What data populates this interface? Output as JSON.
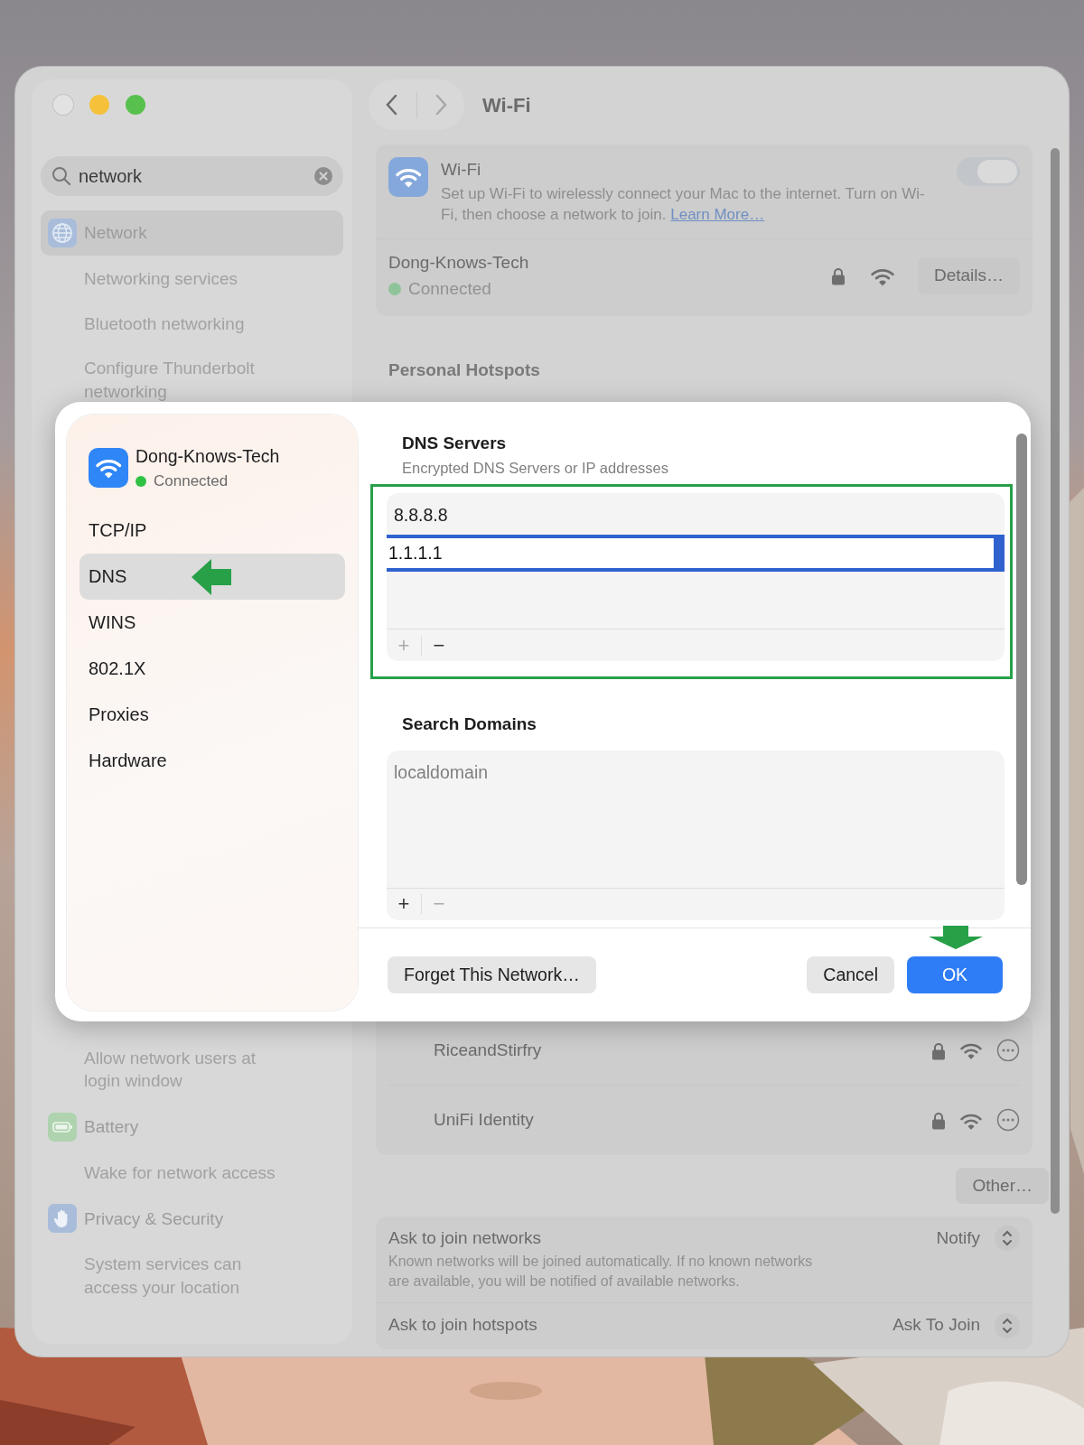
{
  "window": {
    "title": "Wi-Fi",
    "search": {
      "value": "network"
    }
  },
  "sidebar": {
    "top_items": [
      {
        "label": "Network",
        "kind": "pane",
        "selected": true
      },
      {
        "label": "Networking services",
        "kind": "sub",
        "selected": false
      },
      {
        "label": "Bluetooth networking",
        "kind": "sub",
        "selected": false
      },
      {
        "label": "Configure Thunderbolt networking",
        "kind": "sub",
        "selected": false
      }
    ],
    "bottom_items": [
      {
        "label": "Allow network users at login window",
        "kind": "sub",
        "selected": false
      },
      {
        "label": "Battery",
        "kind": "pane",
        "selected": false
      },
      {
        "label": "Wake for network access",
        "kind": "sub",
        "selected": false
      },
      {
        "label": "Privacy & Security",
        "kind": "pane",
        "selected": false
      },
      {
        "label": "System services can access your location",
        "kind": "sub",
        "selected": false
      }
    ]
  },
  "wifi_card": {
    "title": "Wi-Fi",
    "description": "Set up Wi-Fi to wirelessly connect your Mac to the internet. Turn on Wi-Fi, then choose a network to join.",
    "link": "Learn More…",
    "on": true,
    "network": {
      "name": "Dong-Knows-Tech",
      "status": "Connected",
      "button": "Details…"
    }
  },
  "personal_hotspots": {
    "heading": "Personal Hotspots"
  },
  "other_networks": [
    {
      "name": "RiceandStirfry"
    },
    {
      "name": "UniFi Identity"
    }
  ],
  "other_button": "Other…",
  "settings": [
    {
      "label": "Ask to join networks",
      "description": "Known networks will be joined automatically. If no known networks are available, you will be notified of available networks.",
      "value": "Notify"
    },
    {
      "label": "Ask to join hotspots",
      "value": "Ask To Join"
    }
  ],
  "dialog": {
    "network": {
      "name": "Dong-Knows-Tech",
      "status": "Connected"
    },
    "tabs": [
      {
        "label": "TCP/IP",
        "selected": false
      },
      {
        "label": "DNS",
        "selected": true
      },
      {
        "label": "WINS",
        "selected": false
      },
      {
        "label": "802.1X",
        "selected": false
      },
      {
        "label": "Proxies",
        "selected": false
      },
      {
        "label": "Hardware",
        "selected": false
      }
    ],
    "sections": [
      {
        "heading": "DNS Servers",
        "subtitle": "Encrypted DNS Servers or IP addresses",
        "add_label": "+",
        "remove_label": "−",
        "remove_enabled": true,
        "highlighted": true,
        "entries": [
          {
            "value": "8.8.8.8",
            "editing": false
          },
          {
            "value": "1.1.1.1",
            "editing": true
          }
        ]
      },
      {
        "heading": "Search Domains",
        "add_label": "+",
        "remove_label": "−",
        "remove_enabled": false,
        "highlighted": false,
        "entries": [
          {
            "value": "localdomain",
            "editing": false
          }
        ]
      }
    ],
    "buttons": [
      {
        "label": "Forget This Network…",
        "kind": "secondary"
      },
      {
        "label": "Cancel",
        "kind": "secondary"
      },
      {
        "label": "OK",
        "kind": "primary"
      }
    ]
  }
}
